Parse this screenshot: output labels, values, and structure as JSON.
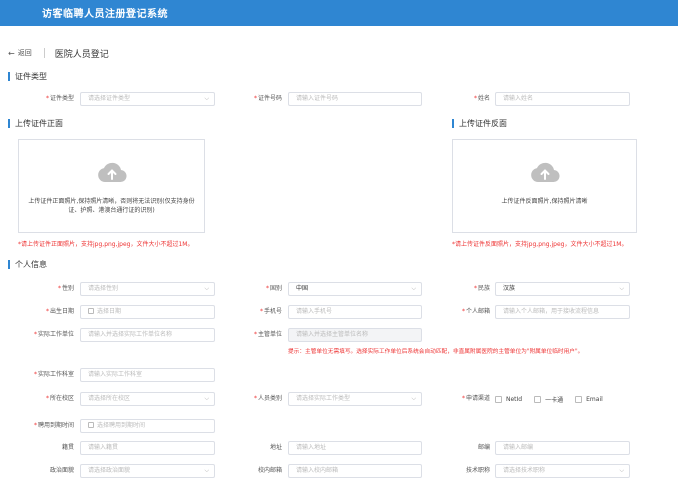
{
  "header": {
    "title": "访客临聘人员注册登记系统"
  },
  "nav": {
    "back": "返回",
    "page_title": "医院人员登记"
  },
  "sections": {
    "id_type": "证件类型",
    "front": "上传证件正面",
    "back": "上传证件反面",
    "personal": "个人信息"
  },
  "id_fields": {
    "id_type_label": "证件类型",
    "id_type_ph": "请选择证件类型",
    "id_no_label": "证件号码",
    "id_no_ph": "请输入证件号码",
    "name_label": "姓名",
    "name_ph": "请输入姓名"
  },
  "upload": {
    "front_hint": "上传证件正面照片,保持照片清晰，否则将无法识别(仅支持身份证、护照、港澳台通行证的识别)",
    "back_hint": "上传证件反面照片,保持照片清晰",
    "front_warn": "*请上传证件正面照片，支持jpg,png,jpeg，文件大小不超过1M。",
    "back_warn": "*请上传证件反面照片，支持jpg,png,jpeg，文件大小不超过1M。"
  },
  "personal": {
    "gender_label": "性别",
    "gender_ph": "请选择性别",
    "nation_label": "国别",
    "nation_val": "中国",
    "ethnic_label": "民族",
    "ethnic_val": "汉族",
    "birth_label": "出生日期",
    "birth_ph": "选择日期",
    "phone_label": "手机号",
    "phone_ph": "请输入手机号",
    "email_label": "个人邮箱",
    "email_ph": "请输入个人邮箱，用于接收流程信息",
    "workunit_label": "实际工作单位",
    "workunit_ph": "请输入并选择实际工作单位名称",
    "mgmt_label": "主管单位",
    "mgmt_ph": "请输入并选择主管单位名称",
    "mgmt_tip": "提示：主管单位无需填写。选择实际工作单位后系统会自动匹配，非直属附属医院的主管单位为\"附属单位临时用户\"。",
    "dept_label": "实际工作科室",
    "dept_ph": "请输入实际工作科室",
    "campus_label": "所在校区",
    "campus_ph": "请选择所在校区",
    "ptype_label": "人员类别",
    "ptype_ph": "请选择实际工作类型",
    "channel_label": "申请渠道",
    "channel_opts": [
      "NetId",
      "一卡通",
      "Email"
    ],
    "term_label": "聘用到期时间",
    "term_ph": "选择聘用到期时间",
    "origin_label": "籍贯",
    "origin_ph": "请输入籍贯",
    "addr_label": "地址",
    "addr_ph": "请输入地址",
    "mail_label": "邮编",
    "mail_ph": "请输入邮编",
    "party_label": "政治面貌",
    "party_ph": "请选择政治面貌",
    "campusmail_label": "校内邮箱",
    "campusmail_ph": "请输入校内邮箱",
    "title_label": "技术职称",
    "title_ph": "请选择技术职称"
  }
}
